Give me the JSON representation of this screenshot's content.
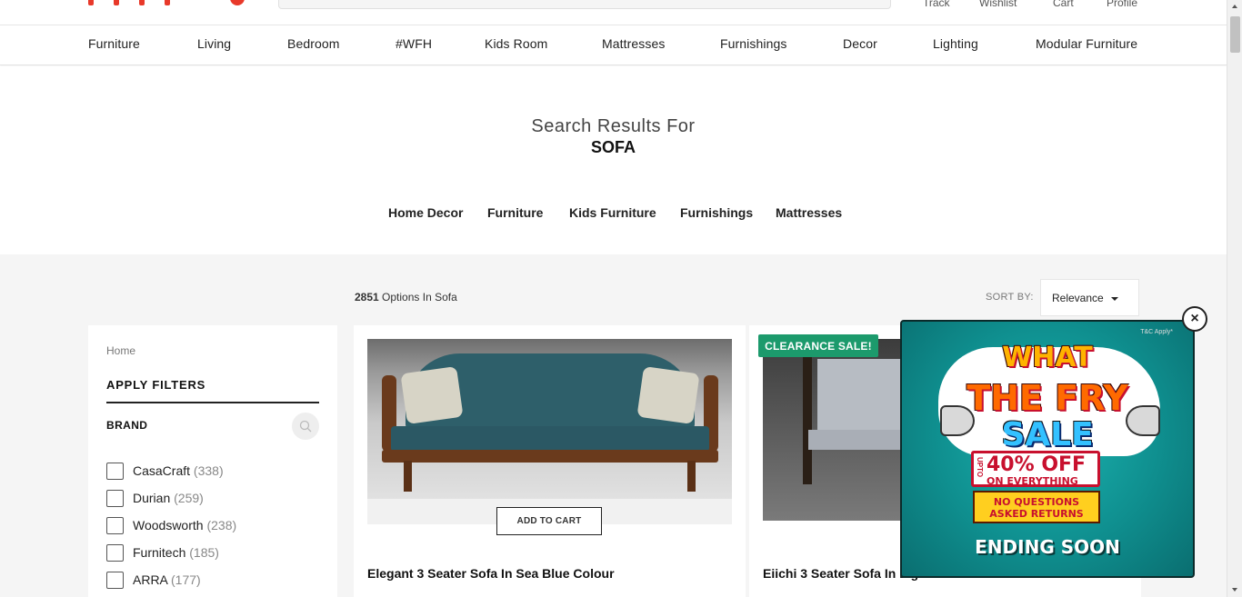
{
  "header": {
    "top_links": [
      "Track",
      "Wishlist",
      "Cart",
      "Profile"
    ]
  },
  "nav": {
    "items": [
      "Furniture",
      "Living",
      "Bedroom",
      "#WFH",
      "Kids Room",
      "Mattresses",
      "Furnishings",
      "Decor",
      "Lighting",
      "Modular Furniture"
    ]
  },
  "results": {
    "label": "Search Results For",
    "query": "SOFA",
    "categories": [
      "Home Decor",
      "Furniture",
      "Kids Furniture",
      "Furnishings",
      "Mattresses"
    ]
  },
  "listing": {
    "count": "2851",
    "count_suffix": "Options In Sofa",
    "sort_label": "SORT BY:",
    "sort_value": "Relevance"
  },
  "filters": {
    "breadcrumb": "Home",
    "title": "APPLY FILTERS",
    "section": "BRAND",
    "brands": [
      {
        "name": "CasaCraft",
        "count": "(338)"
      },
      {
        "name": "Durian",
        "count": "(259)"
      },
      {
        "name": "Woodsworth",
        "count": "(238)"
      },
      {
        "name": "Furnitech",
        "count": "(185)"
      },
      {
        "name": "ARRA",
        "count": "(177)"
      }
    ]
  },
  "products": [
    {
      "title": "Elegant 3 Seater Sofa In Sea Blue Colour",
      "cta": "ADD TO CART"
    },
    {
      "title": "Eiichi 3 Seater Sofa In Light Grey",
      "badge": "CLEARANCE SALE!"
    }
  ],
  "popup": {
    "tc": "T&C Apply*",
    "line1": "WHAT",
    "line2": "THE FRY",
    "line3": "SALE",
    "upto": "UPTO",
    "offer": "40% OFF",
    "offer_sub": "ON EVERYTHING",
    "returns": "NO QUESTIONS ASKED RETURNS",
    "ending": "ENDING SOON",
    "close": "×"
  },
  "colors": {
    "brand_red": "#e8392a",
    "clearance_green": "#1c9a6c",
    "popup_teal": "#0f8f8f"
  }
}
